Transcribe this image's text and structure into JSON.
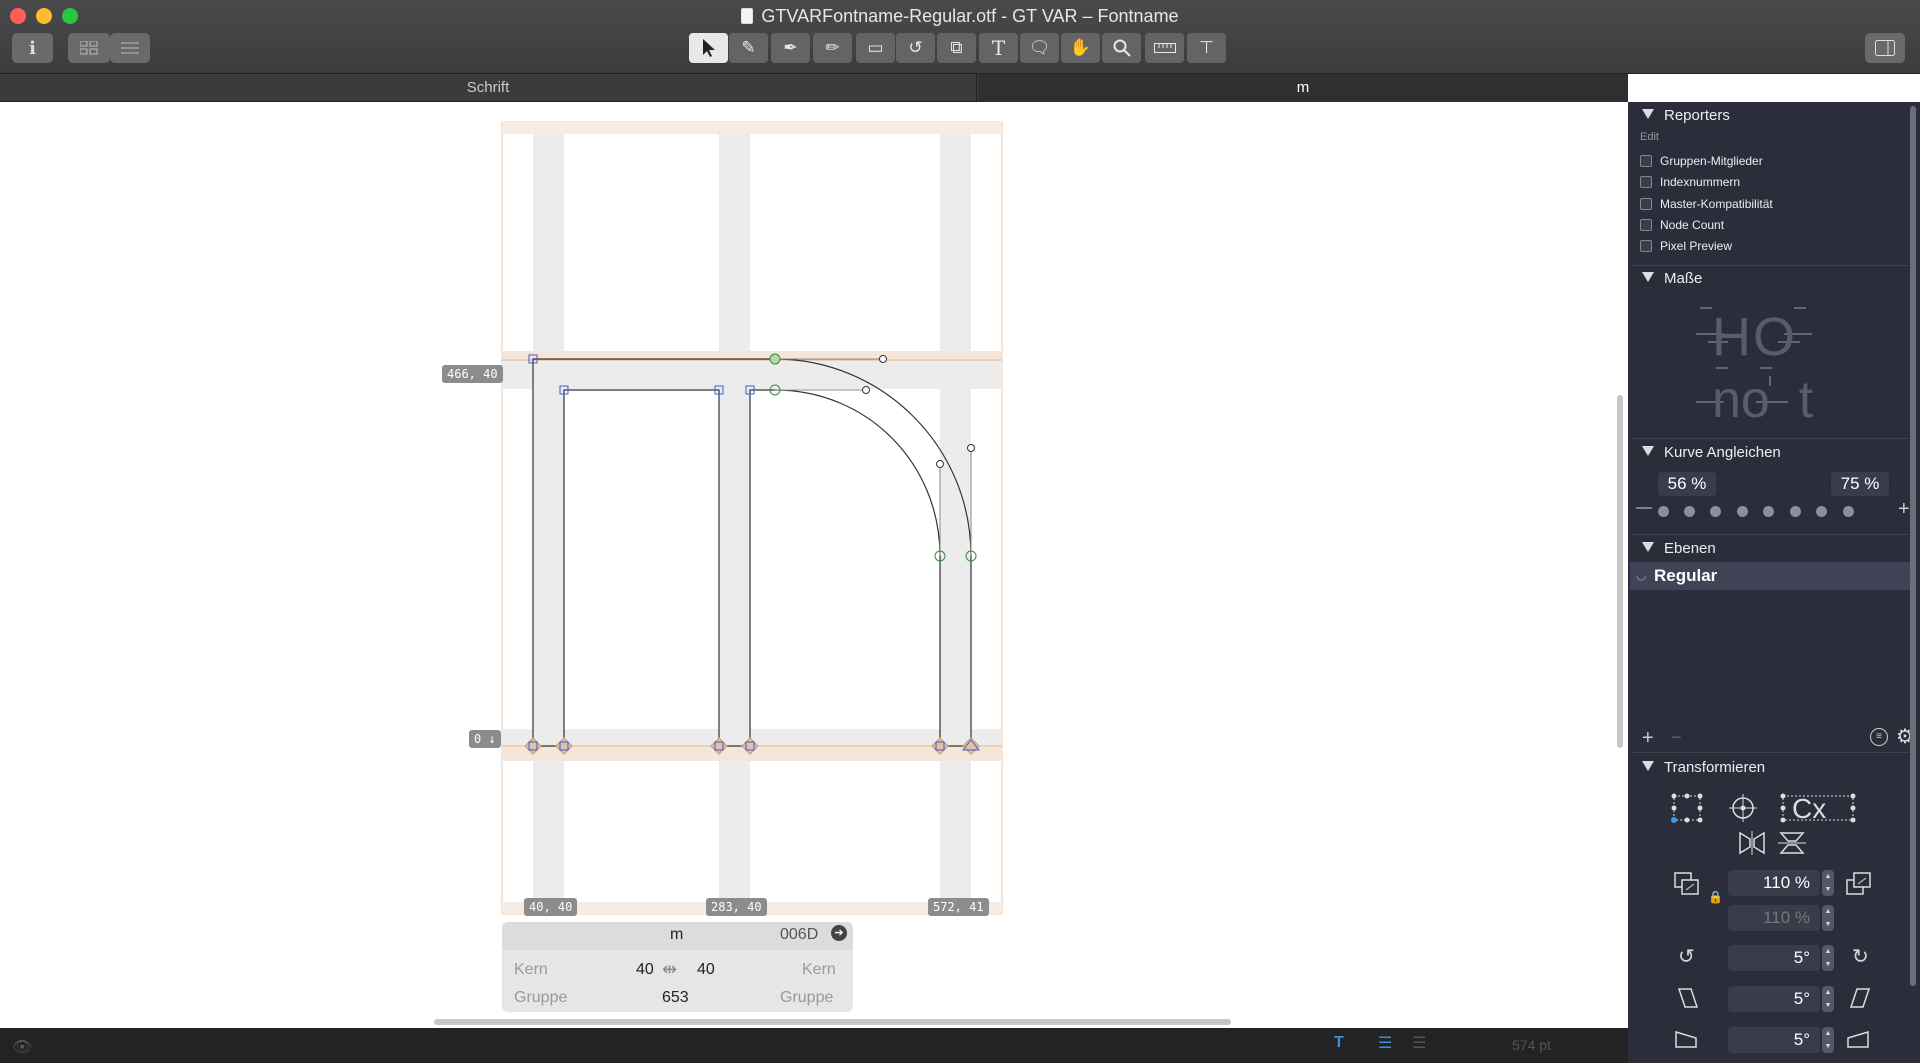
{
  "window": {
    "title": "GTVARFontname-Regular.otf - GT VAR – Fontname"
  },
  "toolbar": {
    "info_icon": "i",
    "tools": [
      "select-tool",
      "draw-tool",
      "pen-tool",
      "pencil-tool",
      "rectangle-tool",
      "rotate-tool",
      "scale-tool",
      "text-tool",
      "annotation-tool",
      "hand-tool",
      "zoom-tool",
      "measure-tool",
      "metrics-tool"
    ]
  },
  "tabs": [
    {
      "label": "Schrift"
    },
    {
      "label": "m"
    }
  ],
  "canvas": {
    "coord_top_left": "466, 40",
    "coord_baseline": "0 ↓",
    "coord_bottom": [
      "40, 40",
      "283, 40",
      "572, 41"
    ]
  },
  "glyph_info": {
    "name": "m",
    "unicode": "006D",
    "kern_left_label": "Kern",
    "kern_right_label": "Kern",
    "lsb": "40",
    "rsb": "40",
    "group_left_label": "Gruppe",
    "group_right_label": "Gruppe",
    "width": "653"
  },
  "sidebar": {
    "reporters": {
      "title": "Reporters",
      "edit": "Edit",
      "items": [
        "Gruppen-Mitglieder",
        "Indexnummern",
        "Master-Kompatibilität",
        "Node Count",
        "Pixel Preview"
      ]
    },
    "masse": {
      "title": "Maße",
      "preview_top": "HO",
      "preview_bottom": "no  t"
    },
    "kurve": {
      "title": "Kurve Angleichen",
      "left_pct": "56 %",
      "right_pct": "75 %",
      "minus": "—",
      "plus": "+"
    },
    "ebenen": {
      "title": "Ebenen",
      "layer": "Regular"
    },
    "transformieren": {
      "title": "Transformieren",
      "scale_x": "110 %",
      "scale_y": "110 %",
      "rotate": "5°",
      "slant": "5°",
      "skew": "5°"
    }
  },
  "status": {
    "size": "574 pt"
  }
}
